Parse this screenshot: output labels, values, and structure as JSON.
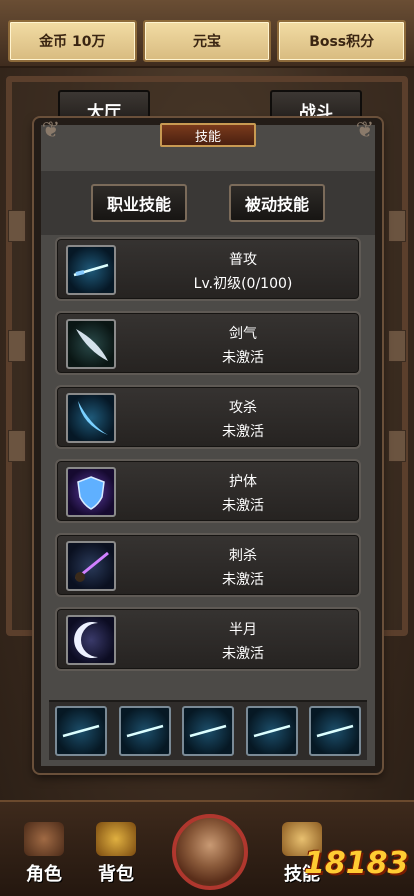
{
  "topbar": {
    "gold": "金币 10万",
    "yuanbao": "元宝",
    "boss_points": "Boss积分"
  },
  "background_tabs": {
    "hall": "大厅",
    "battle": "战斗"
  },
  "panel": {
    "title": "技能",
    "tabs": [
      "职业技能",
      "被动技能"
    ]
  },
  "skills": [
    {
      "name": "普攻",
      "status": "Lv.初级(0/100)",
      "icon": "sword-icon"
    },
    {
      "name": "剑气",
      "status": "未激活",
      "icon": "crescent-slash-icon"
    },
    {
      "name": "攻杀",
      "status": "未激活",
      "icon": "blue-slash-icon"
    },
    {
      "name": "护体",
      "status": "未激活",
      "icon": "shield-icon"
    },
    {
      "name": "刺杀",
      "status": "未激活",
      "icon": "thrust-icon"
    },
    {
      "name": "半月",
      "status": "未激活",
      "icon": "half-moon-icon"
    }
  ],
  "skill_slots": [
    "sword-icon",
    "sword-icon",
    "sword-icon",
    "sword-icon",
    "sword-icon"
  ],
  "nav": {
    "character": "角色",
    "bag": "背包",
    "skill": "技能"
  },
  "watermark": "18183"
}
